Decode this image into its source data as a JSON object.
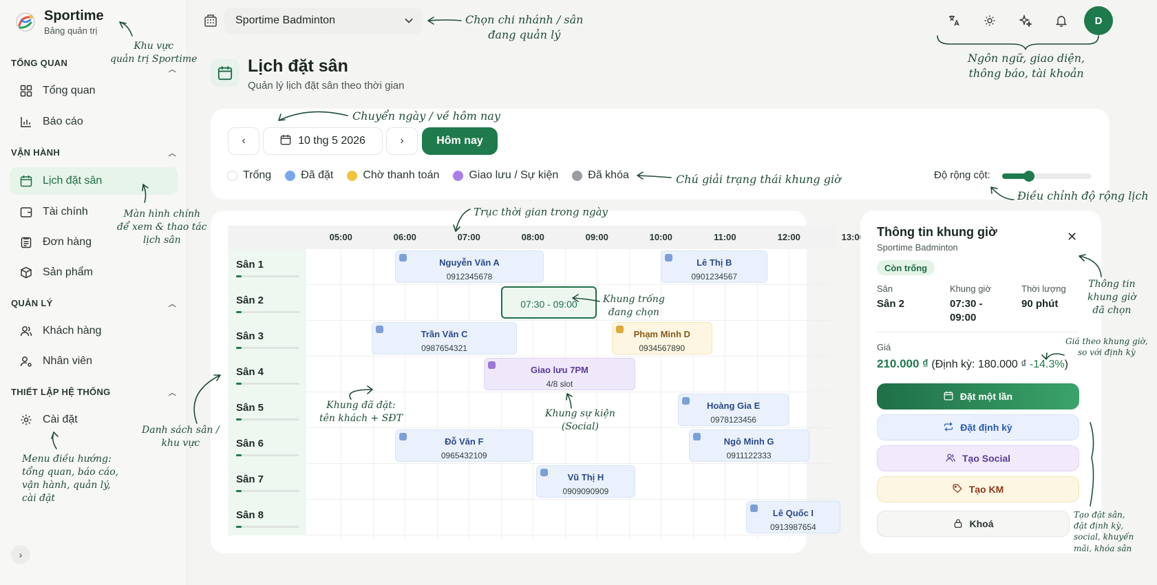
{
  "brand": {
    "name": "Sportime",
    "subtitle": "Bảng quản trị"
  },
  "sidebar": {
    "sections": [
      {
        "label": "TỔNG QUAN",
        "items": [
          {
            "label": "Tổng quan",
            "icon": "grid-icon"
          },
          {
            "label": "Báo cáo",
            "icon": "bar-chart-icon"
          }
        ]
      },
      {
        "label": "VẬN HÀNH",
        "items": [
          {
            "label": "Lịch đặt sân",
            "icon": "calendar-icon",
            "active": true
          },
          {
            "label": "Tài chính",
            "icon": "wallet-icon"
          },
          {
            "label": "Đơn hàng",
            "icon": "clipboard-icon"
          },
          {
            "label": "Sản phẩm",
            "icon": "box-icon"
          }
        ]
      },
      {
        "label": "QUẢN LÝ",
        "items": [
          {
            "label": "Khách hàng",
            "icon": "users-icon"
          },
          {
            "label": "Nhân viên",
            "icon": "user-gear-icon"
          }
        ]
      },
      {
        "label": "THIẾT LẬP HỆ THỐNG",
        "items": [
          {
            "label": "Cài đặt",
            "icon": "gear-icon"
          }
        ]
      }
    ]
  },
  "topbar": {
    "branch": "Sportime Badminton",
    "avatar": "D"
  },
  "page": {
    "title": "Lịch đặt sân",
    "subtitle": "Quản lý lịch đặt sân theo thời gian"
  },
  "toolbar": {
    "date": "10 thg 5 2026",
    "today": "Hôm nay",
    "width_label": "Độ rộng cột:",
    "column_width_level": 0.3
  },
  "legend": [
    {
      "label": "Trống",
      "color": "#ffffff"
    },
    {
      "label": "Đã đặt",
      "color": "#7aa6ef"
    },
    {
      "label": "Chờ thanh toán",
      "color": "#f2c23a"
    },
    {
      "label": "Giao lưu / Sự kiện",
      "color": "#a97ee8"
    },
    {
      "label": "Đã khóa",
      "color": "#9a9ea2"
    }
  ],
  "schedule": {
    "times": [
      "05:00",
      "06:00",
      "07:00",
      "08:00",
      "09:00",
      "10:00",
      "11:00",
      "12:00",
      "13:00"
    ],
    "courts": [
      "Sân 1",
      "Sân 2",
      "Sân 3",
      "Sân 4",
      "Sân 5",
      "Sân 6",
      "Sân 7",
      "Sân 8"
    ],
    "bookings": [
      {
        "court": 0,
        "start": "05:51",
        "end": "08:10",
        "name": "Nguyễn Văn A",
        "phone": "0912345678",
        "status": "booked"
      },
      {
        "court": 0,
        "start": "10:00",
        "end": "11:40",
        "name": "Lê Thị B",
        "phone": "0901234567",
        "status": "booked"
      },
      {
        "court": 1,
        "start": "07:30",
        "end": "09:00",
        "name": "07:30 - 09:00",
        "status": "selected"
      },
      {
        "court": 2,
        "start": "05:29",
        "end": "07:45",
        "name": "Trần Văn C",
        "phone": "0987654321",
        "status": "booked"
      },
      {
        "court": 2,
        "start": "09:14",
        "end": "10:48",
        "name": "Phạm Minh D",
        "phone": "0934567890",
        "status": "pending"
      },
      {
        "court": 3,
        "start": "07:14",
        "end": "09:36",
        "name": "Giao lưu 7PM",
        "phone": "4/8 slot",
        "status": "event"
      },
      {
        "court": 4,
        "start": "10:16",
        "end": "12:00",
        "name": "Hoàng Gia E",
        "phone": "0978123456",
        "status": "booked"
      },
      {
        "court": 5,
        "start": "05:51",
        "end": "08:00",
        "name": "Đỗ Văn F",
        "phone": "0965432109",
        "status": "booked"
      },
      {
        "court": 5,
        "start": "10:26",
        "end": "12:19",
        "name": "Ngô Minh G",
        "phone": "0911122333",
        "status": "booked"
      },
      {
        "court": 6,
        "start": "08:03",
        "end": "09:36",
        "name": "Vũ Thị H",
        "phone": "0909090909",
        "status": "booked"
      },
      {
        "court": 7,
        "start": "11:20",
        "end": "12:48",
        "name": "Lê Quốc I",
        "phone": "0913987654",
        "status": "booked"
      }
    ]
  },
  "detail": {
    "title": "Thông tin khung giờ",
    "venue": "Sportime Badminton",
    "badge": "Còn trống",
    "court_label": "Sân",
    "court_value": "Sân 2",
    "slot_label": "Khung giờ",
    "slot_value_line1": "07:30 -",
    "slot_value_line2": "09:00",
    "duration_label": "Thời lượng",
    "duration_value": "90 phút",
    "price_label": "Giá",
    "price_value": "210.000 ₫",
    "price_compare": "(Định kỳ: 180.000 ₫",
    "price_pct": "-14.3%",
    "price_close": ")",
    "actions": [
      {
        "label": "Đặt một lần",
        "icon": "calendar-icon"
      },
      {
        "label": "Đặt định kỳ",
        "icon": "repeat-icon"
      },
      {
        "label": "Tạo Social",
        "icon": "users-icon"
      },
      {
        "label": "Tạo KM",
        "icon": "tag-icon"
      },
      {
        "label": "Khoá",
        "icon": "lock-icon"
      }
    ]
  },
  "annotations": {
    "admin_area": "Khu vực\nquản trị Sportime",
    "branch": "Chọn chi nhánh / sân\nđang quản lý",
    "account": "Ngôn ngữ, giao diện,\nthông báo, tài khoản",
    "date_nav": "Chuyển ngày / về hôm nay",
    "legend_note": "Chú giải trạng thái khung giờ",
    "width_note": "Điều chỉnh độ rộng lịch",
    "timeline_note": "Trục thời gian trong ngày",
    "main_screen": "Màn hình chính\nđể xem & thao tác\nlịch sân",
    "court_list": "Danh sách sân /\nkhu vực",
    "nav_menu": "Menu điều hướng:\ntổng quan, báo cáo,\nvận hành, quản lý,\ncài đặt",
    "booked_note": "Khung đã đặt:\ntên khách + SĐT",
    "free_note": "Khung trống\nđang chọn",
    "event_note": "Khung sự kiện\n(Social)",
    "selected_info": "Thông tin\nkhung giờ\nđã chọn",
    "price_note": "Giá theo khung giờ,\nso với định kỳ",
    "actions_note": "Tạo đặt sân,\nđặt định kỳ,\nsocial, khuyến\nmãi, khóa sân"
  }
}
